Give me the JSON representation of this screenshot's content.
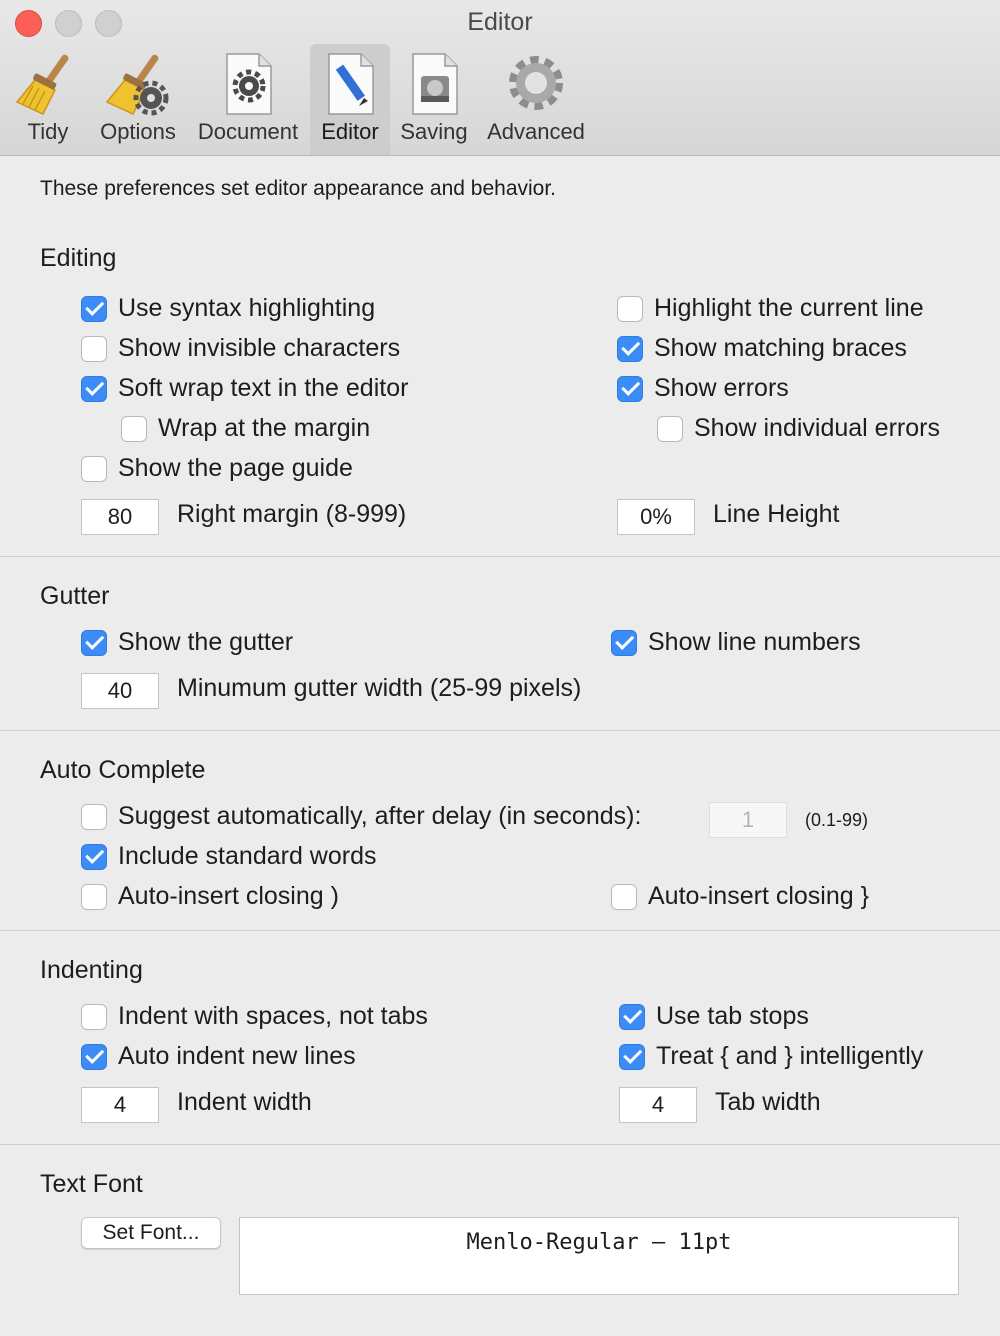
{
  "window": {
    "title": "Editor"
  },
  "toolbar": {
    "items": [
      {
        "label": "Tidy",
        "icon": "broom-icon"
      },
      {
        "label": "Options",
        "icon": "broom-gear-icon"
      },
      {
        "label": "Document",
        "icon": "document-gear-icon"
      },
      {
        "label": "Editor",
        "icon": "document-pencil-icon",
        "selected": true
      },
      {
        "label": "Saving",
        "icon": "document-disk-icon"
      },
      {
        "label": "Advanced",
        "icon": "gear-icon"
      }
    ]
  },
  "intro": "These preferences set editor appearance and behavior.",
  "editing": {
    "title": "Editing",
    "syntax_highlighting": {
      "label": "Use syntax highlighting",
      "checked": true
    },
    "show_invisibles": {
      "label": "Show invisible characters",
      "checked": false
    },
    "soft_wrap": {
      "label": "Soft wrap text in the editor",
      "checked": true
    },
    "wrap_margin": {
      "label": "Wrap at the margin",
      "checked": false
    },
    "page_guide": {
      "label": "Show the page guide",
      "checked": false
    },
    "highlight_line": {
      "label": "Highlight the current line",
      "checked": false
    },
    "matching_braces": {
      "label": "Show matching braces",
      "checked": true
    },
    "show_errors": {
      "label": "Show errors",
      "checked": true
    },
    "individual_errors": {
      "label": "Show individual errors",
      "checked": false
    },
    "right_margin": {
      "value": "80",
      "label": "Right margin (8-999)"
    },
    "line_height": {
      "value": "0%",
      "label": "Line Height"
    }
  },
  "gutter": {
    "title": "Gutter",
    "show_gutter": {
      "label": "Show the gutter",
      "checked": true
    },
    "line_numbers": {
      "label": "Show line numbers",
      "checked": true
    },
    "min_width": {
      "value": "40",
      "label": "Minumum gutter width (25-99 pixels)"
    }
  },
  "autocomplete": {
    "title": "Auto Complete",
    "suggest": {
      "label": "Suggest automatically, after delay (in seconds):",
      "checked": false
    },
    "delay": {
      "value": "1",
      "range": "(0.1-99)"
    },
    "standard_words": {
      "label": "Include standard words",
      "checked": true
    },
    "close_paren": {
      "label": "Auto-insert closing )",
      "checked": false
    },
    "close_brace": {
      "label": "Auto-insert closing }",
      "checked": false
    }
  },
  "indenting": {
    "title": "Indenting",
    "spaces": {
      "label": "Indent with spaces, not tabs",
      "checked": false
    },
    "auto_indent": {
      "label": "Auto indent new lines",
      "checked": true
    },
    "tab_stops": {
      "label": "Use tab stops",
      "checked": true
    },
    "braces_smart": {
      "label": "Treat { and } intelligently",
      "checked": true
    },
    "indent_width": {
      "value": "4",
      "label": "Indent width"
    },
    "tab_width": {
      "value": "4",
      "label": "Tab width"
    }
  },
  "text_font": {
    "title": "Text Font",
    "button": "Set Font...",
    "font_display": "Menlo-Regular – 11pt"
  },
  "colors": {
    "accent": "#3b8cf6",
    "close": "#fc5f57"
  }
}
